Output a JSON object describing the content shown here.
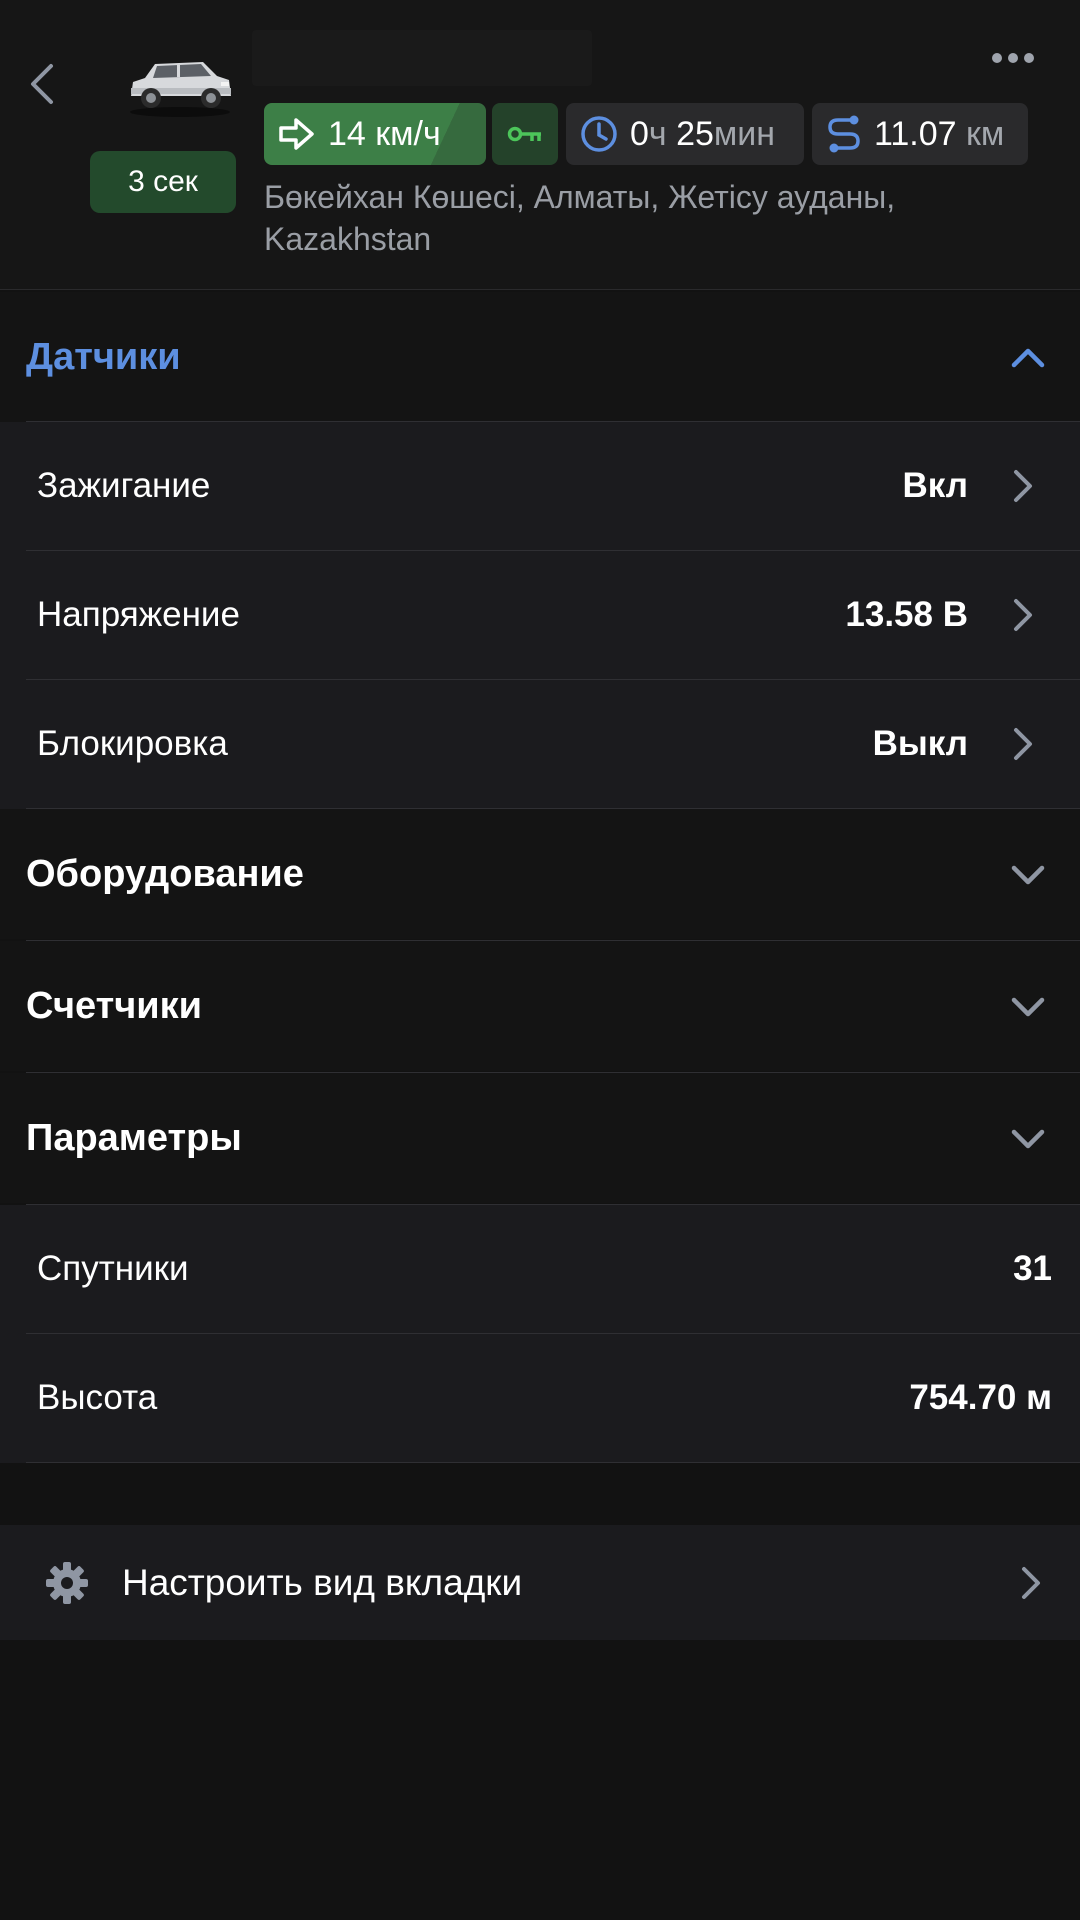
{
  "header": {
    "age_badge": "3 сек",
    "speed": {
      "value": "14",
      "unit": "км/ч"
    },
    "duration": {
      "hours": "0",
      "hours_unit": "ч",
      "minutes": "25",
      "minutes_unit": "мин"
    },
    "distance": {
      "value": "11.07",
      "unit": "км"
    },
    "address": "Бөкейхан Көшесі, Алматы, Жетісу ауданы, Kazakhstan",
    "icons": {
      "back": "chevron-left-icon",
      "more": "more-dots-icon",
      "car": "car-icon",
      "speed": "arrow-right-icon",
      "ignition": "key-icon",
      "duration": "clock-icon",
      "distance": "route-icon"
    }
  },
  "sections": {
    "sensors": {
      "title": "Датчики",
      "expanded": true,
      "items": [
        {
          "label": "Зажигание",
          "value": "Вкл"
        },
        {
          "label": "Напряжение",
          "value": "13.58 В"
        },
        {
          "label": "Блокировка",
          "value": "Выкл"
        }
      ]
    },
    "equipment": {
      "title": "Оборудование",
      "expanded": false
    },
    "counters": {
      "title": "Счетчики",
      "expanded": false
    },
    "parameters": {
      "title": "Параметры",
      "expanded": false,
      "items": [
        {
          "label": "Спутники",
          "value": "31"
        },
        {
          "label": "Высота",
          "value": "754.70 м"
        }
      ]
    }
  },
  "settings": {
    "label": "Настроить вид вкладки",
    "icon": "gear-icon"
  },
  "colors": {
    "background": "#121212",
    "row_background": "#1b1b1e",
    "accent_blue": "#5d8fe0",
    "speed_green": "#3d7f47",
    "ignition_green": "#4cc55a",
    "chip_gray": "#2a2a2c"
  }
}
